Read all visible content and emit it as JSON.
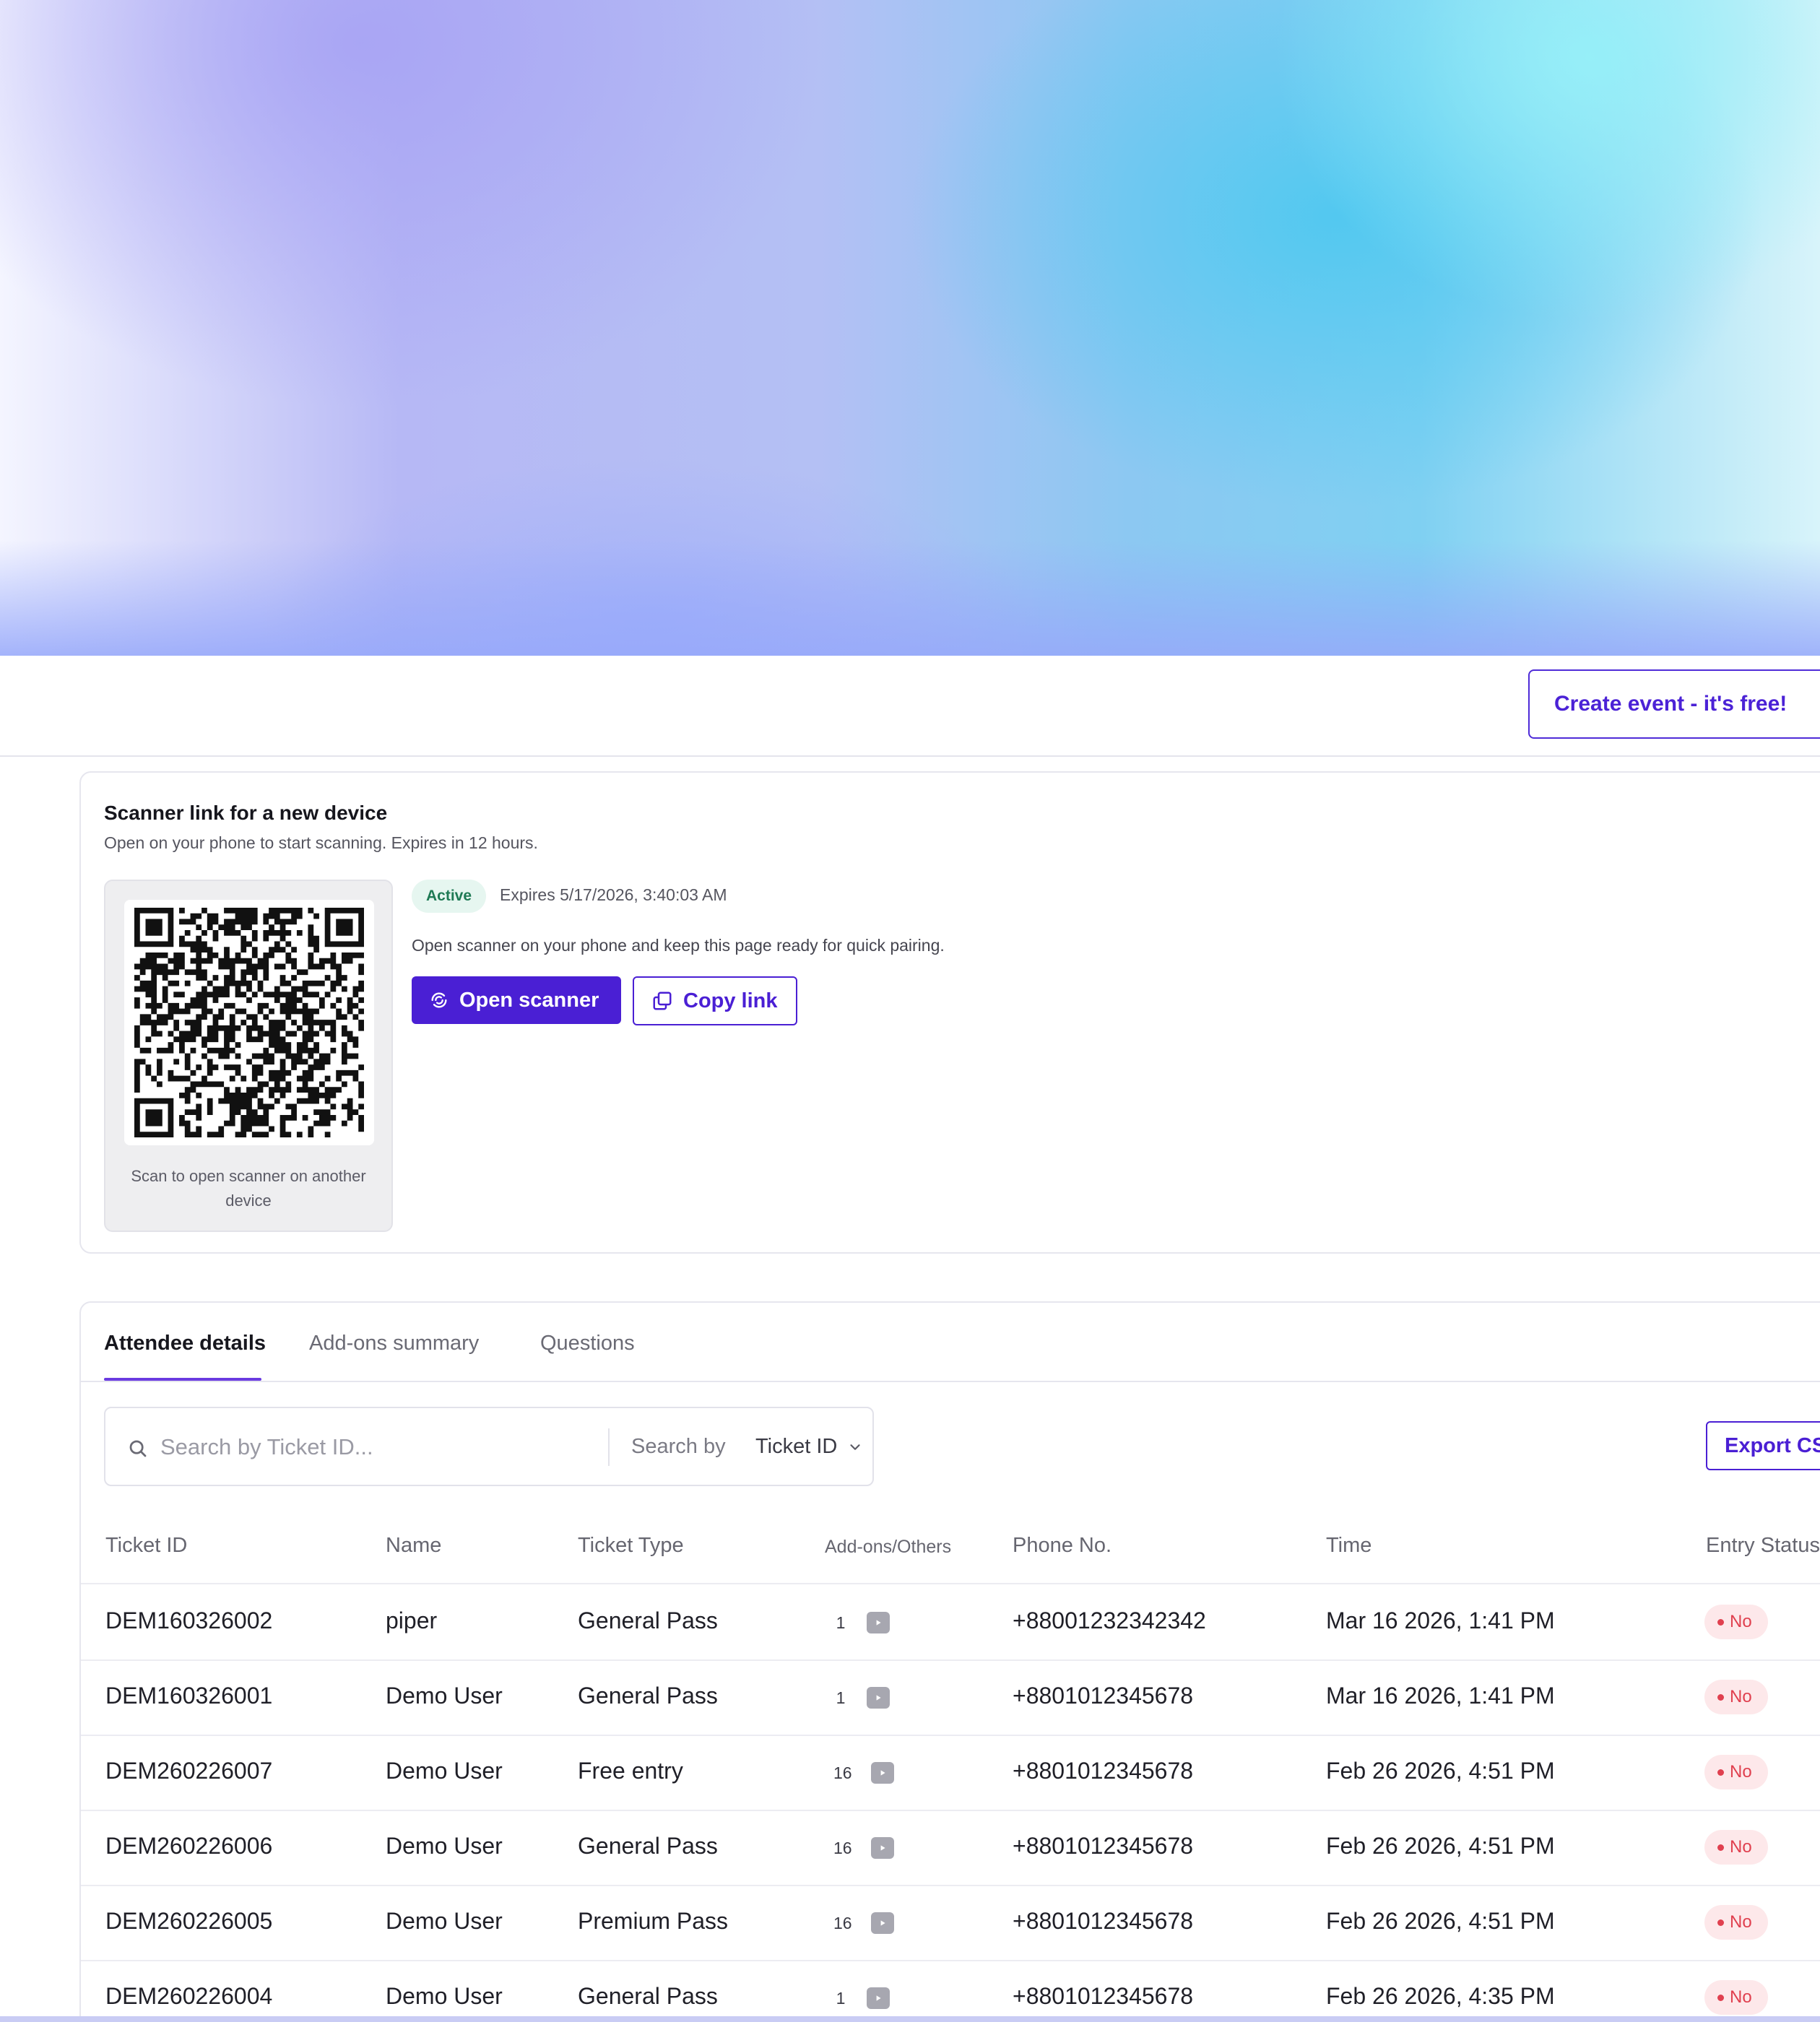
{
  "header": {
    "create_event_label": "Create event - it's free!"
  },
  "scanner": {
    "title": "Scanner link for a new device",
    "subtitle": "Open on your phone to start scanning. Expires in 12 hours.",
    "status": "Active",
    "expires": "Expires 5/17/2026, 3:40:03 AM",
    "description": "Open scanner on your phone and keep this page ready for quick pairing.",
    "open_label": "Open scanner",
    "copy_label": "Copy link",
    "qr_caption": "Scan to open scanner on another device"
  },
  "tabs": [
    {
      "label": "Attendee details",
      "active": true
    },
    {
      "label": "Add-ons summary",
      "active": false
    },
    {
      "label": "Questions",
      "active": false
    }
  ],
  "search": {
    "placeholder": "Search by Ticket ID...",
    "search_by_label": "Search by",
    "selected_field": "Ticket ID"
  },
  "export_label": "Export CSV",
  "table": {
    "columns": [
      "Ticket ID",
      "Name",
      "Ticket Type",
      "Add-ons/Others",
      "Phone No.",
      "Time",
      "Entry Status"
    ],
    "rows": [
      {
        "ticket_id": "DEM160326002",
        "name": "piper",
        "type": "General Pass",
        "addons": "1",
        "phone": "+88001232342342",
        "time": "Mar 16 2026, 1:41 PM",
        "status": "No"
      },
      {
        "ticket_id": "DEM160326001",
        "name": "Demo User",
        "type": "General Pass",
        "addons": "1",
        "phone": "+8801012345678",
        "time": "Mar 16 2026, 1:41 PM",
        "status": "No"
      },
      {
        "ticket_id": "DEM260226007",
        "name": "Demo User",
        "type": "Free entry",
        "addons": "16",
        "phone": "+8801012345678",
        "time": "Feb 26 2026, 4:51 PM",
        "status": "No"
      },
      {
        "ticket_id": "DEM260226006",
        "name": "Demo User",
        "type": "General Pass",
        "addons": "16",
        "phone": "+8801012345678",
        "time": "Feb 26 2026, 4:51 PM",
        "status": "No"
      },
      {
        "ticket_id": "DEM260226005",
        "name": "Demo User",
        "type": "Premium Pass",
        "addons": "16",
        "phone": "+8801012345678",
        "time": "Feb 26 2026, 4:51 PM",
        "status": "No"
      },
      {
        "ticket_id": "DEM260226004",
        "name": "Demo User",
        "type": "General Pass",
        "addons": "1",
        "phone": "+8801012345678",
        "time": "Feb 26 2026, 4:35 PM",
        "status": "No"
      }
    ]
  },
  "colors": {
    "brand": "#4a1fd4",
    "tab_underline": "#6a3be0",
    "status_no_bg": "#fde8ea",
    "status_no_text": "#e0404f",
    "active_badge_bg": "#e6f6f0",
    "active_badge_text": "#1f7a55"
  }
}
